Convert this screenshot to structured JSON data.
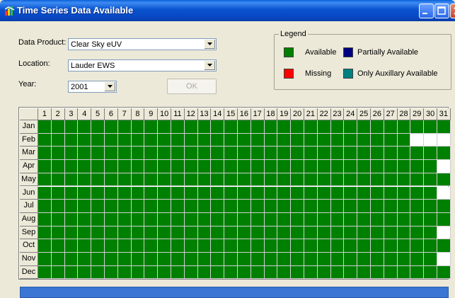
{
  "window": {
    "title": "Time Series Data Available"
  },
  "colors": {
    "available": "#008000",
    "partial": "#000080",
    "missing": "#ff0000",
    "auxiliary": "#008080",
    "empty": "#ffffff"
  },
  "form": {
    "product_label": "Data Product:",
    "product_value": "Clear Sky eUV",
    "location_label": "Location:",
    "location_value": "Lauder EWS",
    "year_label": "Year:",
    "year_value": "2001",
    "ok_label": "OK"
  },
  "legend": {
    "title": "Legend",
    "available": "Available",
    "partial": "Partially Available",
    "missing": "Missing",
    "auxiliary": "Only Auxillary Available"
  },
  "calendar": {
    "days": [
      "1",
      "2",
      "3",
      "4",
      "5",
      "6",
      "7",
      "8",
      "9",
      "10",
      "11",
      "12",
      "13",
      "14",
      "15",
      "16",
      "17",
      "18",
      "19",
      "20",
      "21",
      "22",
      "23",
      "24",
      "25",
      "26",
      "27",
      "28",
      "29",
      "30",
      "31"
    ],
    "months": [
      {
        "name": "Jan",
        "days_available": 31
      },
      {
        "name": "Feb",
        "days_available": 28
      },
      {
        "name": "Mar",
        "days_available": 31
      },
      {
        "name": "Apr",
        "days_available": 30
      },
      {
        "name": "May",
        "days_available": 31
      },
      {
        "name": "Jun",
        "days_available": 30
      },
      {
        "name": "Jul",
        "days_available": 31
      },
      {
        "name": "Aug",
        "days_available": 31
      },
      {
        "name": "Sep",
        "days_available": 30
      },
      {
        "name": "Oct",
        "days_available": 31
      },
      {
        "name": "Nov",
        "days_available": 30
      },
      {
        "name": "Dec",
        "days_available": 31
      }
    ]
  }
}
